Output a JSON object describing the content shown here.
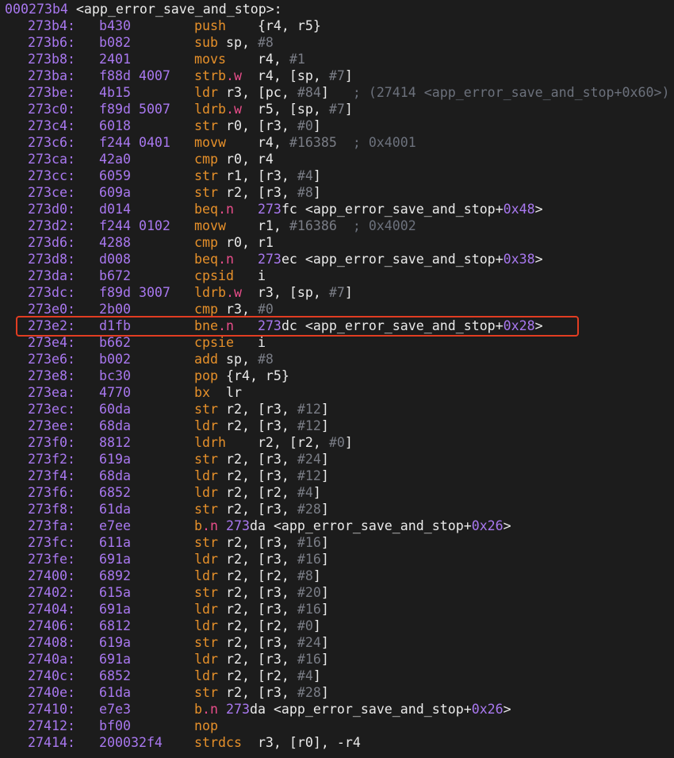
{
  "header": {
    "addr": "000273b4",
    "label": " <app_error_save_and_stop>:"
  },
  "colors": {
    "background": "#1c1c1c",
    "address": "#a978f0",
    "mnemonic": "#e6902a",
    "suffix": "#e84d8a",
    "immediate": "#7a7d86",
    "highlight_border": "#e13d22"
  },
  "rows": [
    {
      "addr": "273b4:",
      "hex": "b430",
      "asm": [
        [
          "m",
          "push    "
        ],
        [
          "p",
          "{r4, r5}"
        ]
      ]
    },
    {
      "addr": "273b6:",
      "hex": "b082",
      "asm": [
        [
          "m",
          "sub "
        ],
        [
          "p",
          "sp, "
        ],
        [
          "i",
          "#8"
        ]
      ]
    },
    {
      "addr": "273b8:",
      "hex": "2401",
      "asm": [
        [
          "m",
          "movs    "
        ],
        [
          "p",
          "r4, "
        ],
        [
          "i",
          "#1"
        ]
      ]
    },
    {
      "addr": "273ba:",
      "hex": "f88d 4007",
      "asm": [
        [
          "m",
          "strb"
        ],
        [
          "s",
          ".w"
        ],
        [
          "p",
          "  r4, [sp, "
        ],
        [
          "i",
          "#7"
        ],
        [
          "p",
          "]"
        ]
      ]
    },
    {
      "addr": "273be:",
      "hex": "4b15",
      "asm": [
        [
          "m",
          "ldr "
        ],
        [
          "p",
          "r3, [pc, "
        ],
        [
          "i",
          "#84"
        ],
        [
          "p",
          "]"
        ],
        [
          "c",
          "   ; (27414 <app_error_save_and_stop+0x60>)"
        ]
      ]
    },
    {
      "addr": "273c0:",
      "hex": "f89d 5007",
      "asm": [
        [
          "m",
          "ldrb"
        ],
        [
          "s",
          ".w"
        ],
        [
          "p",
          "  r5, [sp, "
        ],
        [
          "i",
          "#7"
        ],
        [
          "p",
          "]"
        ]
      ]
    },
    {
      "addr": "273c4:",
      "hex": "6018",
      "asm": [
        [
          "m",
          "str "
        ],
        [
          "p",
          "r0, [r3, "
        ],
        [
          "i",
          "#0"
        ],
        [
          "p",
          "]"
        ]
      ]
    },
    {
      "addr": "273c6:",
      "hex": "f244 0401",
      "asm": [
        [
          "m",
          "movw    "
        ],
        [
          "p",
          "r4, "
        ],
        [
          "i",
          "#16385"
        ],
        [
          "c",
          "  ; 0x4001"
        ]
      ]
    },
    {
      "addr": "273ca:",
      "hex": "42a0",
      "asm": [
        [
          "m",
          "cmp "
        ],
        [
          "p",
          "r0, r4"
        ]
      ]
    },
    {
      "addr": "273cc:",
      "hex": "6059",
      "asm": [
        [
          "m",
          "str "
        ],
        [
          "p",
          "r1, [r3, "
        ],
        [
          "i",
          "#4"
        ],
        [
          "p",
          "]"
        ]
      ]
    },
    {
      "addr": "273ce:",
      "hex": "609a",
      "asm": [
        [
          "m",
          "str "
        ],
        [
          "p",
          "r2, [r3, "
        ],
        [
          "i",
          "#8"
        ],
        [
          "p",
          "]"
        ]
      ]
    },
    {
      "addr": "273d0:",
      "hex": "d014",
      "asm": [
        [
          "m",
          "beq"
        ],
        [
          "s",
          ".n"
        ],
        [
          "p",
          "   "
        ],
        [
          "a",
          "273"
        ],
        [
          "p",
          "fc <app_error_save_and_stop+"
        ],
        [
          "a",
          "0x48"
        ],
        [
          "p",
          ">"
        ]
      ]
    },
    {
      "addr": "273d2:",
      "hex": "f244 0102",
      "asm": [
        [
          "m",
          "movw    "
        ],
        [
          "p",
          "r1, "
        ],
        [
          "i",
          "#16386"
        ],
        [
          "c",
          "  ; 0x4002"
        ]
      ]
    },
    {
      "addr": "273d6:",
      "hex": "4288",
      "asm": [
        [
          "m",
          "cmp "
        ],
        [
          "p",
          "r0, r1"
        ]
      ]
    },
    {
      "addr": "273d8:",
      "hex": "d008",
      "asm": [
        [
          "m",
          "beq"
        ],
        [
          "s",
          ".n"
        ],
        [
          "p",
          "   "
        ],
        [
          "a",
          "273"
        ],
        [
          "p",
          "ec <app_error_save_and_stop+"
        ],
        [
          "a",
          "0x38"
        ],
        [
          "p",
          ">"
        ]
      ]
    },
    {
      "addr": "273da:",
      "hex": "b672",
      "asm": [
        [
          "m",
          "cpsid   "
        ],
        [
          "p",
          "i"
        ]
      ]
    },
    {
      "addr": "273dc:",
      "hex": "f89d 3007",
      "asm": [
        [
          "m",
          "ldrb"
        ],
        [
          "s",
          ".w"
        ],
        [
          "p",
          "  r3, [sp, "
        ],
        [
          "i",
          "#7"
        ],
        [
          "p",
          "]"
        ]
      ]
    },
    {
      "addr": "273e0:",
      "hex": "2b00",
      "asm": [
        [
          "m",
          "cmp "
        ],
        [
          "p",
          "r3, "
        ],
        [
          "i",
          "#0"
        ]
      ]
    },
    {
      "addr": "273e2:",
      "hex": "d1fb",
      "asm": [
        [
          "m",
          "bne"
        ],
        [
          "s",
          ".n"
        ],
        [
          "p",
          "   "
        ],
        [
          "a",
          "273"
        ],
        [
          "p",
          "dc <app_error_save_and_stop+"
        ],
        [
          "a",
          "0x28"
        ],
        [
          "p",
          ">"
        ]
      ]
    },
    {
      "addr": "273e4:",
      "hex": "b662",
      "asm": [
        [
          "m",
          "cpsie   "
        ],
        [
          "p",
          "i"
        ]
      ]
    },
    {
      "addr": "273e6:",
      "hex": "b002",
      "asm": [
        [
          "m",
          "add "
        ],
        [
          "p",
          "sp, "
        ],
        [
          "i",
          "#8"
        ]
      ]
    },
    {
      "addr": "273e8:",
      "hex": "bc30",
      "asm": [
        [
          "m",
          "pop "
        ],
        [
          "p",
          "{r4, r5}"
        ]
      ]
    },
    {
      "addr": "273ea:",
      "hex": "4770",
      "asm": [
        [
          "m",
          "bx  "
        ],
        [
          "p",
          "lr"
        ]
      ]
    },
    {
      "addr": "273ec:",
      "hex": "60da",
      "asm": [
        [
          "m",
          "str "
        ],
        [
          "p",
          "r2, [r3, "
        ],
        [
          "i",
          "#12"
        ],
        [
          "p",
          "]"
        ]
      ]
    },
    {
      "addr": "273ee:",
      "hex": "68da",
      "asm": [
        [
          "m",
          "ldr "
        ],
        [
          "p",
          "r2, [r3, "
        ],
        [
          "i",
          "#12"
        ],
        [
          "p",
          "]"
        ]
      ]
    },
    {
      "addr": "273f0:",
      "hex": "8812",
      "asm": [
        [
          "m",
          "ldrh    "
        ],
        [
          "p",
          "r2, [r2, "
        ],
        [
          "i",
          "#0"
        ],
        [
          "p",
          "]"
        ]
      ]
    },
    {
      "addr": "273f2:",
      "hex": "619a",
      "asm": [
        [
          "m",
          "str "
        ],
        [
          "p",
          "r2, [r3, "
        ],
        [
          "i",
          "#24"
        ],
        [
          "p",
          "]"
        ]
      ]
    },
    {
      "addr": "273f4:",
      "hex": "68da",
      "asm": [
        [
          "m",
          "ldr "
        ],
        [
          "p",
          "r2, [r3, "
        ],
        [
          "i",
          "#12"
        ],
        [
          "p",
          "]"
        ]
      ]
    },
    {
      "addr": "273f6:",
      "hex": "6852",
      "asm": [
        [
          "m",
          "ldr "
        ],
        [
          "p",
          "r2, [r2, "
        ],
        [
          "i",
          "#4"
        ],
        [
          "p",
          "]"
        ]
      ]
    },
    {
      "addr": "273f8:",
      "hex": "61da",
      "asm": [
        [
          "m",
          "str "
        ],
        [
          "p",
          "r2, [r3, "
        ],
        [
          "i",
          "#28"
        ],
        [
          "p",
          "]"
        ]
      ]
    },
    {
      "addr": "273fa:",
      "hex": "e7ee",
      "asm": [
        [
          "m",
          "b"
        ],
        [
          "s",
          ".n "
        ],
        [
          "a",
          "273"
        ],
        [
          "p",
          "da <app_error_save_and_stop+"
        ],
        [
          "a",
          "0x26"
        ],
        [
          "p",
          ">"
        ]
      ]
    },
    {
      "addr": "273fc:",
      "hex": "611a",
      "asm": [
        [
          "m",
          "str "
        ],
        [
          "p",
          "r2, [r3, "
        ],
        [
          "i",
          "#16"
        ],
        [
          "p",
          "]"
        ]
      ]
    },
    {
      "addr": "273fe:",
      "hex": "691a",
      "asm": [
        [
          "m",
          "ldr "
        ],
        [
          "p",
          "r2, [r3, "
        ],
        [
          "i",
          "#16"
        ],
        [
          "p",
          "]"
        ]
      ]
    },
    {
      "addr": "27400:",
      "hex": "6892",
      "asm": [
        [
          "m",
          "ldr "
        ],
        [
          "p",
          "r2, [r2, "
        ],
        [
          "i",
          "#8"
        ],
        [
          "p",
          "]"
        ]
      ]
    },
    {
      "addr": "27402:",
      "hex": "615a",
      "asm": [
        [
          "m",
          "str "
        ],
        [
          "p",
          "r2, [r3, "
        ],
        [
          "i",
          "#20"
        ],
        [
          "p",
          "]"
        ]
      ]
    },
    {
      "addr": "27404:",
      "hex": "691a",
      "asm": [
        [
          "m",
          "ldr "
        ],
        [
          "p",
          "r2, [r3, "
        ],
        [
          "i",
          "#16"
        ],
        [
          "p",
          "]"
        ]
      ]
    },
    {
      "addr": "27406:",
      "hex": "6812",
      "asm": [
        [
          "m",
          "ldr "
        ],
        [
          "p",
          "r2, [r2, "
        ],
        [
          "i",
          "#0"
        ],
        [
          "p",
          "]"
        ]
      ]
    },
    {
      "addr": "27408:",
      "hex": "619a",
      "asm": [
        [
          "m",
          "str "
        ],
        [
          "p",
          "r2, [r3, "
        ],
        [
          "i",
          "#24"
        ],
        [
          "p",
          "]"
        ]
      ]
    },
    {
      "addr": "2740a:",
      "hex": "691a",
      "asm": [
        [
          "m",
          "ldr "
        ],
        [
          "p",
          "r2, [r3, "
        ],
        [
          "i",
          "#16"
        ],
        [
          "p",
          "]"
        ]
      ]
    },
    {
      "addr": "2740c:",
      "hex": "6852",
      "asm": [
        [
          "m",
          "ldr "
        ],
        [
          "p",
          "r2, [r2, "
        ],
        [
          "i",
          "#4"
        ],
        [
          "p",
          "]"
        ]
      ]
    },
    {
      "addr": "2740e:",
      "hex": "61da",
      "asm": [
        [
          "m",
          "str "
        ],
        [
          "p",
          "r2, [r3, "
        ],
        [
          "i",
          "#28"
        ],
        [
          "p",
          "]"
        ]
      ]
    },
    {
      "addr": "27410:",
      "hex": "e7e3",
      "asm": [
        [
          "m",
          "b"
        ],
        [
          "s",
          ".n "
        ],
        [
          "a",
          "273"
        ],
        [
          "p",
          "da <app_error_save_and_stop+"
        ],
        [
          "a",
          "0x26"
        ],
        [
          "p",
          ">"
        ]
      ]
    },
    {
      "addr": "27412:",
      "hex": "bf00",
      "asm": [
        [
          "m",
          "nop"
        ]
      ]
    },
    {
      "addr": "27414:",
      "hex": "200032f4",
      "asm": [
        [
          "m",
          "strdcs  "
        ],
        [
          "p",
          "r3, [r0], -r4"
        ]
      ]
    }
  ],
  "highlighted_row": "273e2:"
}
